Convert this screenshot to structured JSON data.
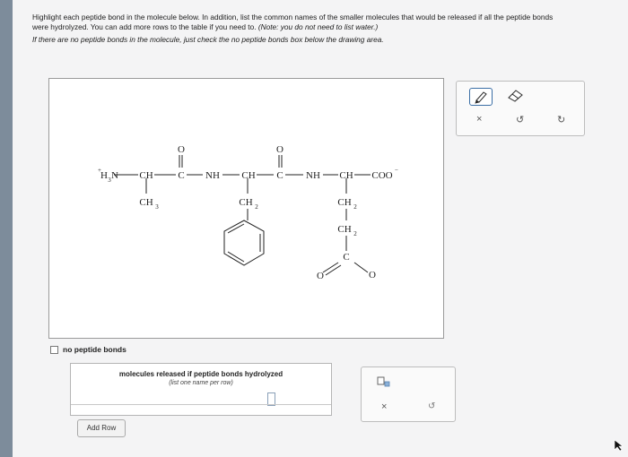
{
  "instructions": {
    "line1": "Highlight each peptide bond in the molecule below. In addition, list the common names of the smaller molecules that would be released if all the peptide bonds",
    "line2_a": "were hydrolyzed. You can add more rows to the table if you need to. ",
    "line2_b": "(Note: you do not need to list water.)",
    "line3_a": "If there are ",
    "line3_b": "no",
    "line3_c": " peptide bonds in the molecule, just check the ",
    "line3_d": "no peptide bonds",
    "line3_e": " box below the drawing area."
  },
  "molecule": {
    "h3n_H": "H",
    "h3n_sub": "3",
    "h3n_N": "N",
    "plus": "+",
    "ch1": "CH",
    "ch3": "CH",
    "ch3_sub": "3",
    "c1": "C",
    "o1": "O",
    "nh1": "NH",
    "ch2_main": "CH",
    "ch2_side": "CH",
    "ch2_side_sub": "2",
    "c2": "C",
    "o2": "O",
    "nh2": "NH",
    "ch3_main": "CH",
    "coo": "COO",
    "minus": "−",
    "ch2_a": "CH",
    "ch2_a_sub": "2",
    "ch2_b": "CH",
    "ch2_b_sub": "2",
    "c_side": "C",
    "o_left": "O",
    "o_right": "O"
  },
  "toolbox": {
    "clear": "×",
    "undo": "↺",
    "redo": "↻"
  },
  "no_peptide_bonds_label": "no peptide bonds",
  "table": {
    "header": "molecules released if peptide bonds hydrolyzed",
    "subheader": "(list one name per row)"
  },
  "add_row_label": "Add Row",
  "side_controls": {
    "clear": "×",
    "undo": "↺"
  },
  "icons": {
    "pencil": "pencil-icon",
    "eraser": "eraser-icon",
    "subscript": "subscript-icon"
  }
}
